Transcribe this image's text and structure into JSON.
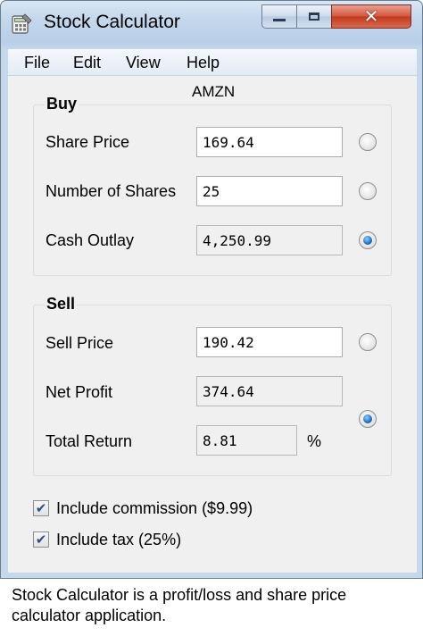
{
  "window": {
    "title": "Stock Calculator",
    "icon": "calculator-icon"
  },
  "menu": {
    "items": [
      "File",
      "Edit",
      "View",
      "Help"
    ]
  },
  "symbol": "AMZN",
  "buy": {
    "group_title": "Buy",
    "share_price": {
      "label": "Share Price",
      "value": "169.64",
      "selected": false
    },
    "num_shares": {
      "label": "Number of Shares",
      "value": "25",
      "selected": false
    },
    "cash_outlay": {
      "label": "Cash Outlay",
      "value": "4,250.99",
      "selected": true
    }
  },
  "sell": {
    "group_title": "Sell",
    "sell_price": {
      "label": "Sell Price",
      "value": "190.42",
      "selected": false
    },
    "net_profit": {
      "label": "Net Profit",
      "value": "374.64"
    },
    "total_return": {
      "label": "Total Return",
      "value": "8.81",
      "unit": "%"
    },
    "profit_return_selected": true
  },
  "options": {
    "commission": {
      "label": "Include commission ($9.99)",
      "checked": true
    },
    "tax": {
      "label": "Include tax (25%)",
      "checked": true
    }
  },
  "caption": "Stock Calculator is a profit/loss and share price calculator application.",
  "colors": {
    "radio_selected": "#1b6fc4",
    "close_button": "#c23a1e",
    "titlebar": "#c4d7ec"
  }
}
